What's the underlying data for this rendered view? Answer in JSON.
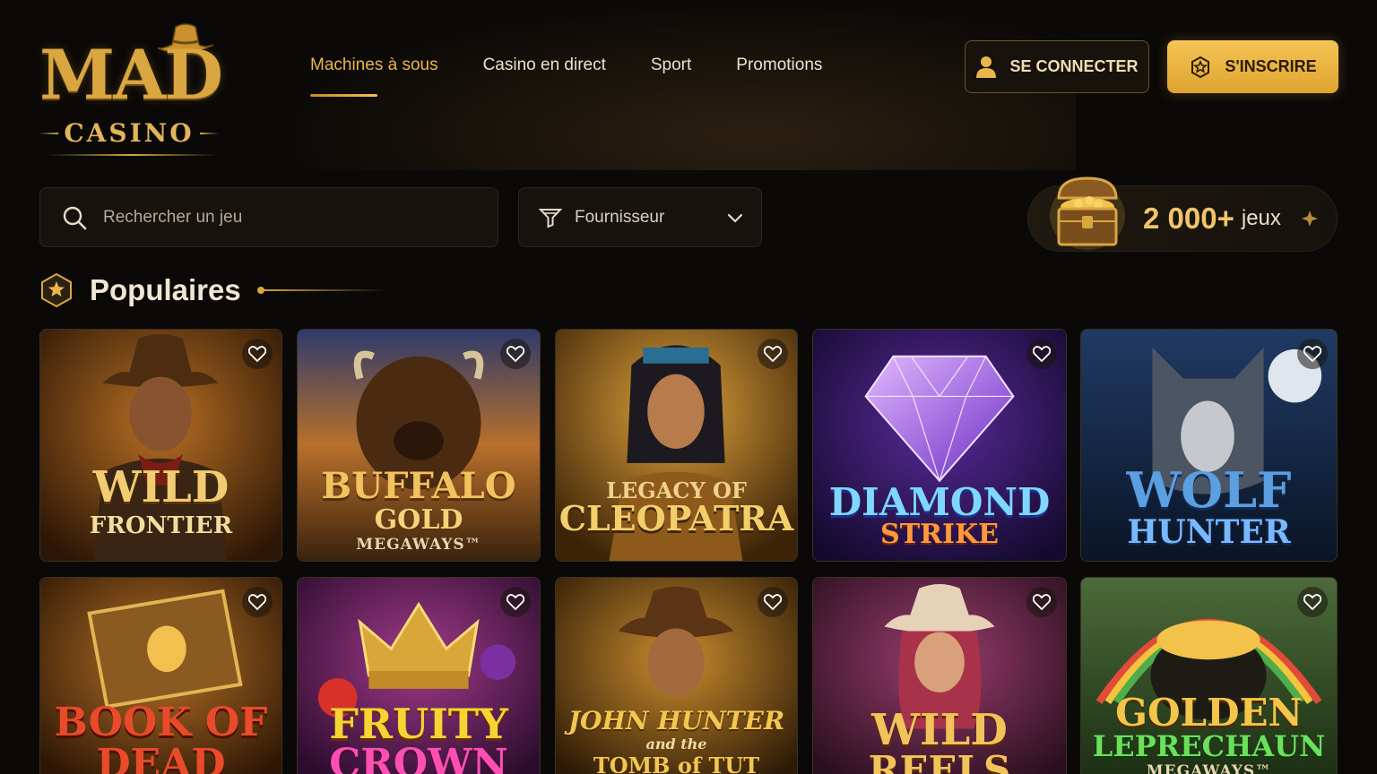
{
  "brand": {
    "name_top": "MAD",
    "name_bottom": "CASINO"
  },
  "nav": {
    "items": [
      {
        "label": "Machines à sous",
        "active": true
      },
      {
        "label": "Casino en direct",
        "active": false
      },
      {
        "label": "Sport",
        "active": false
      },
      {
        "label": "Promotions",
        "active": false
      }
    ]
  },
  "auth": {
    "login_label": "SE CONNECTER",
    "signup_label": "S'INSCRIRE"
  },
  "search": {
    "placeholder": "Rechercher un jeu"
  },
  "filter": {
    "provider_label": "Fournisseur"
  },
  "games_count": {
    "count": "2 000+",
    "unit": "jeux"
  },
  "section": {
    "title": "Populaires"
  },
  "colors": {
    "accent": "#eab54a",
    "background": "#0b0907",
    "card_border": "#3b3122"
  },
  "games": [
    {
      "line1": "WILD",
      "line2": "FRONTIER",
      "line3": "",
      "theme": "cowboy"
    },
    {
      "line1": "BUFFALO",
      "line2": "GOLD",
      "line3": "MEGAWAYS™",
      "theme": "buffalo"
    },
    {
      "line1": "LEGACY OF",
      "line2": "CLEOPATRA",
      "line3": "",
      "theme": "egypt"
    },
    {
      "line1": "DIAMOND",
      "line2": "STRIKE",
      "line3": "",
      "theme": "diamond"
    },
    {
      "line1": "WOLF",
      "line2": "HUNTER",
      "line3": "",
      "theme": "wolf"
    },
    {
      "line1": "BOOK OF",
      "line2": "DEAD",
      "line3": "",
      "theme": "book"
    },
    {
      "line1": "FRUITY",
      "line2": "CROWN",
      "line3": "",
      "theme": "fruit"
    },
    {
      "line1": "JOHN HUNTER",
      "line2": "and the",
      "line3": "TOMB of TUT",
      "theme": "hunter"
    },
    {
      "line1": "WILD",
      "line2": "REELS",
      "line3": "",
      "theme": "cowgirl"
    },
    {
      "line1": "GOLDEN",
      "line2": "LEPRECHAUN",
      "line3": "MEGAWAYS™",
      "theme": "leprechaun"
    }
  ]
}
